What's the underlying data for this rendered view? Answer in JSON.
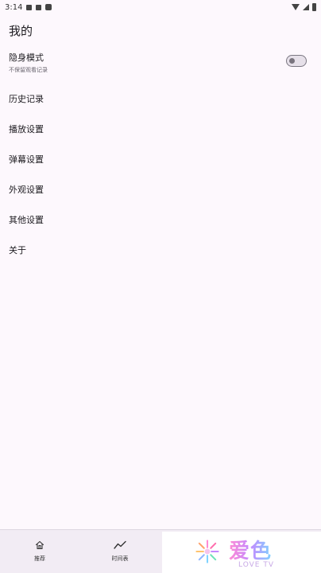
{
  "status_bar": {
    "time": "3:14"
  },
  "page": {
    "title": "我的"
  },
  "settings": {
    "incognito": {
      "title": "隐身模式",
      "subtitle": "不保留观看记录",
      "enabled": false
    },
    "items": [
      {
        "label": "历史记录"
      },
      {
        "label": "播放设置"
      },
      {
        "label": "弹幕设置"
      },
      {
        "label": "外观设置"
      },
      {
        "label": "其他设置"
      },
      {
        "label": "关于"
      }
    ]
  },
  "bottom_nav": {
    "items": [
      {
        "label": "推荐",
        "icon": "home-icon"
      },
      {
        "label": "时间表",
        "icon": "trend-icon"
      }
    ]
  },
  "watermark": {
    "text": "爱色",
    "subtext": "LOVE TV"
  }
}
